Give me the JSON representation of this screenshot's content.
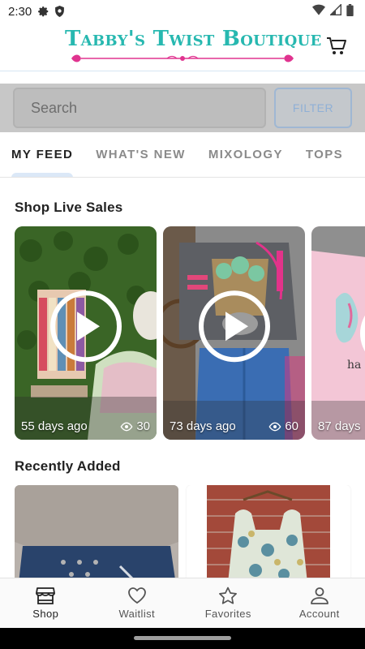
{
  "status_bar": {
    "time": "2:30"
  },
  "header": {
    "logo_text": "Tabby's Twist Boutique"
  },
  "search": {
    "placeholder": "Search",
    "filter_label": "FILTER"
  },
  "tabs": [
    {
      "label": "MY FEED",
      "active": true
    },
    {
      "label": "WHAT'S NEW",
      "active": false
    },
    {
      "label": "MIXOLOGY",
      "active": false
    },
    {
      "label": "TOPS",
      "active": false
    }
  ],
  "live_sales": {
    "title": "Shop Live Sales",
    "items": [
      {
        "age": "55 days ago",
        "views": "30"
      },
      {
        "age": "73 days ago",
        "views": "60"
      },
      {
        "age": "87 days",
        "views": ""
      }
    ]
  },
  "recently_added": {
    "title": "Recently Added"
  },
  "bottom_nav": [
    {
      "label": "Shop",
      "icon": "store-icon",
      "active": true
    },
    {
      "label": "Waitlist",
      "icon": "heart-icon",
      "active": false
    },
    {
      "label": "Favorites",
      "icon": "star-icon",
      "active": false
    },
    {
      "label": "Account",
      "icon": "person-icon",
      "active": false
    }
  ],
  "colors": {
    "logo": "#27b8b0",
    "flourish": "#e0338f",
    "tab_indicator": "#dbe8f7"
  }
}
